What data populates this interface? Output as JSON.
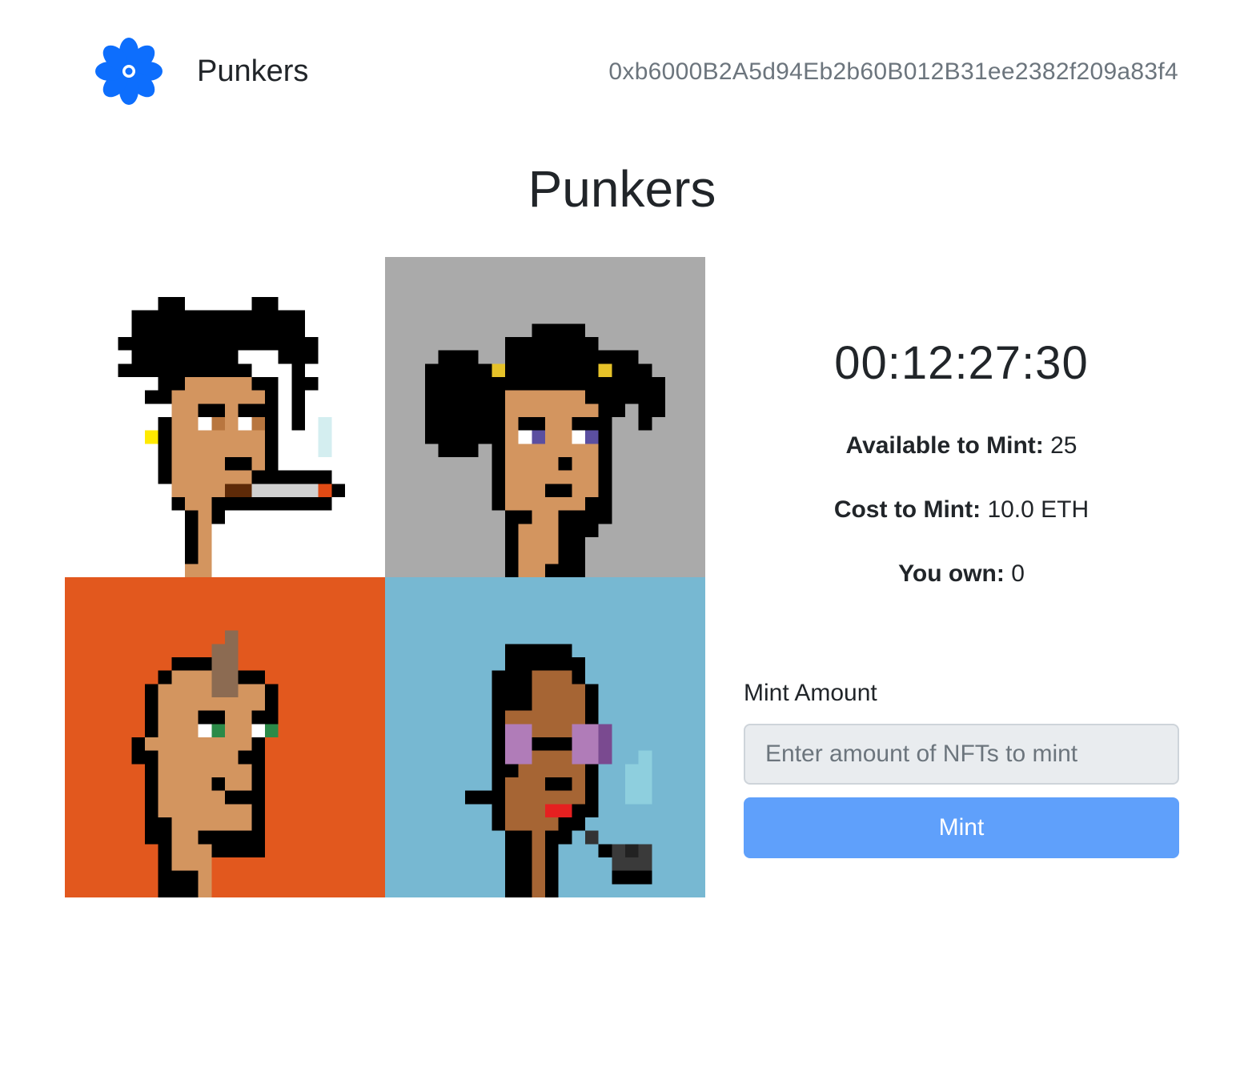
{
  "navbar": {
    "logo_icon": "flower-icon",
    "logo_color": "#0d6efd",
    "brand": "Punkers",
    "wallet_address": "0xb6000B2A5d94Eb2b60B012B31ee2382f209a83f4"
  },
  "main": {
    "title": "Punkers",
    "punks": [
      {
        "name": "punk-smoker",
        "background": "#ffffff"
      },
      {
        "name": "punk-pigtails",
        "background": "#aaaaaa"
      },
      {
        "name": "punk-mohawk",
        "background": "#e2581e"
      },
      {
        "name": "punk-pipe-glasses",
        "background": "#77b8d2"
      }
    ],
    "countdown": "00:12:27:30",
    "stats": {
      "available_label": "Available to Mint:",
      "available_value": "25",
      "cost_label": "Cost to Mint:",
      "cost_value": "10.0 ETH",
      "owned_label": "You own:",
      "owned_value": "0"
    },
    "mint": {
      "label": "Mint Amount",
      "placeholder": "Enter amount of NFTs to mint",
      "value": "",
      "button_label": "Mint",
      "button_color": "#5fa0fb"
    }
  }
}
